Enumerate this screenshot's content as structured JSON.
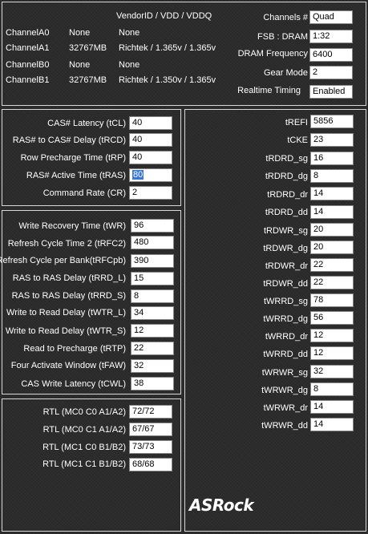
{
  "top": {
    "header": "VendorID / VDD / VDDQ",
    "channels": [
      {
        "name": "ChannelA0",
        "size": "None",
        "info": "None"
      },
      {
        "name": "ChannelA1",
        "size": "32767MB",
        "info": "Richtek / 1.365v / 1.365v"
      },
      {
        "name": "ChannelB0",
        "size": "None",
        "info": "None"
      },
      {
        "name": "ChannelB1",
        "size": "32767MB",
        "info": "Richtek / 1.350v / 1.365v"
      }
    ],
    "settings": [
      {
        "label": "Channels #",
        "value": "Quad"
      },
      {
        "label": "FSB : DRAM",
        "value": "1:32"
      },
      {
        "label": "DRAM Frequency",
        "value": "6400"
      },
      {
        "label": "Gear Mode",
        "value": "2"
      },
      {
        "label": "Realtime Timing",
        "value": "Enabled"
      }
    ]
  },
  "primary": [
    {
      "label": "CAS# Latency (tCL)",
      "value": "40"
    },
    {
      "label": "RAS# to CAS# Delay (tRCD)",
      "value": "40"
    },
    {
      "label": "Row Precharge Time (tRP)",
      "value": "40"
    },
    {
      "label": "RAS# Active Time (tRAS)",
      "value": "80"
    },
    {
      "label": "Command Rate (CR)",
      "value": "2"
    }
  ],
  "secondary": [
    {
      "label": "Write Recovery Time (tWR)",
      "value": "96"
    },
    {
      "label": "Refresh Cycle Time 2 (tRFC2)",
      "value": "480"
    },
    {
      "label": "Refresh Cycle per Bank(tRFCpb)",
      "value": "390"
    },
    {
      "label": "RAS to RAS Delay (tRRD_L)",
      "value": "15"
    },
    {
      "label": "RAS to RAS Delay (tRRD_S)",
      "value": "8"
    },
    {
      "label": "Write to Read Delay (tWTR_L)",
      "value": "34"
    },
    {
      "label": "Write to Read Delay (tWTR_S)",
      "value": "12"
    },
    {
      "label": "Read to Precharge (tRTP)",
      "value": "22"
    },
    {
      "label": "Four Activate Window (tFAW)",
      "value": "32"
    },
    {
      "label": "CAS Write Latency (tCWL)",
      "value": "38"
    }
  ],
  "rtl": [
    {
      "label": "RTL (MC0 C0 A1/A2)",
      "value": "72/72"
    },
    {
      "label": "RTL (MC0 C1 A1/A2)",
      "value": "67/67"
    },
    {
      "label": "RTL (MC1 C0 B1/B2)",
      "value": "73/73"
    },
    {
      "label": "RTL (MC1 C1 B1/B2)",
      "value": "68/68"
    }
  ],
  "tertiary": [
    {
      "label": "tREFI",
      "value": "5856"
    },
    {
      "label": "tCKE",
      "value": "23"
    },
    {
      "label": "tRDRD_sg",
      "value": "16"
    },
    {
      "label": "tRDRD_dg",
      "value": "8"
    },
    {
      "label": "tRDRD_dr",
      "value": "14"
    },
    {
      "label": "tRDRD_dd",
      "value": "14"
    },
    {
      "label": "tRDWR_sg",
      "value": "20"
    },
    {
      "label": "tRDWR_dg",
      "value": "20"
    },
    {
      "label": "tRDWR_dr",
      "value": "22"
    },
    {
      "label": "tRDWR_dd",
      "value": "22"
    },
    {
      "label": "tWRRD_sg",
      "value": "78"
    },
    {
      "label": "tWRRD_dg",
      "value": "56"
    },
    {
      "label": "tWRRD_dr",
      "value": "12"
    },
    {
      "label": "tWRRD_dd",
      "value": "12"
    },
    {
      "label": "tWRWR_sg",
      "value": "32"
    },
    {
      "label": "tWRWR_dg",
      "value": "8"
    },
    {
      "label": "tWRWR_dr",
      "value": "14"
    },
    {
      "label": "tWRWR_dd",
      "value": "14"
    }
  ],
  "branding": {
    "logo": "ASRock"
  },
  "colors": {
    "background": "#2b2b2b",
    "border": "#d8d8d8",
    "selection": "#3a78d6"
  }
}
